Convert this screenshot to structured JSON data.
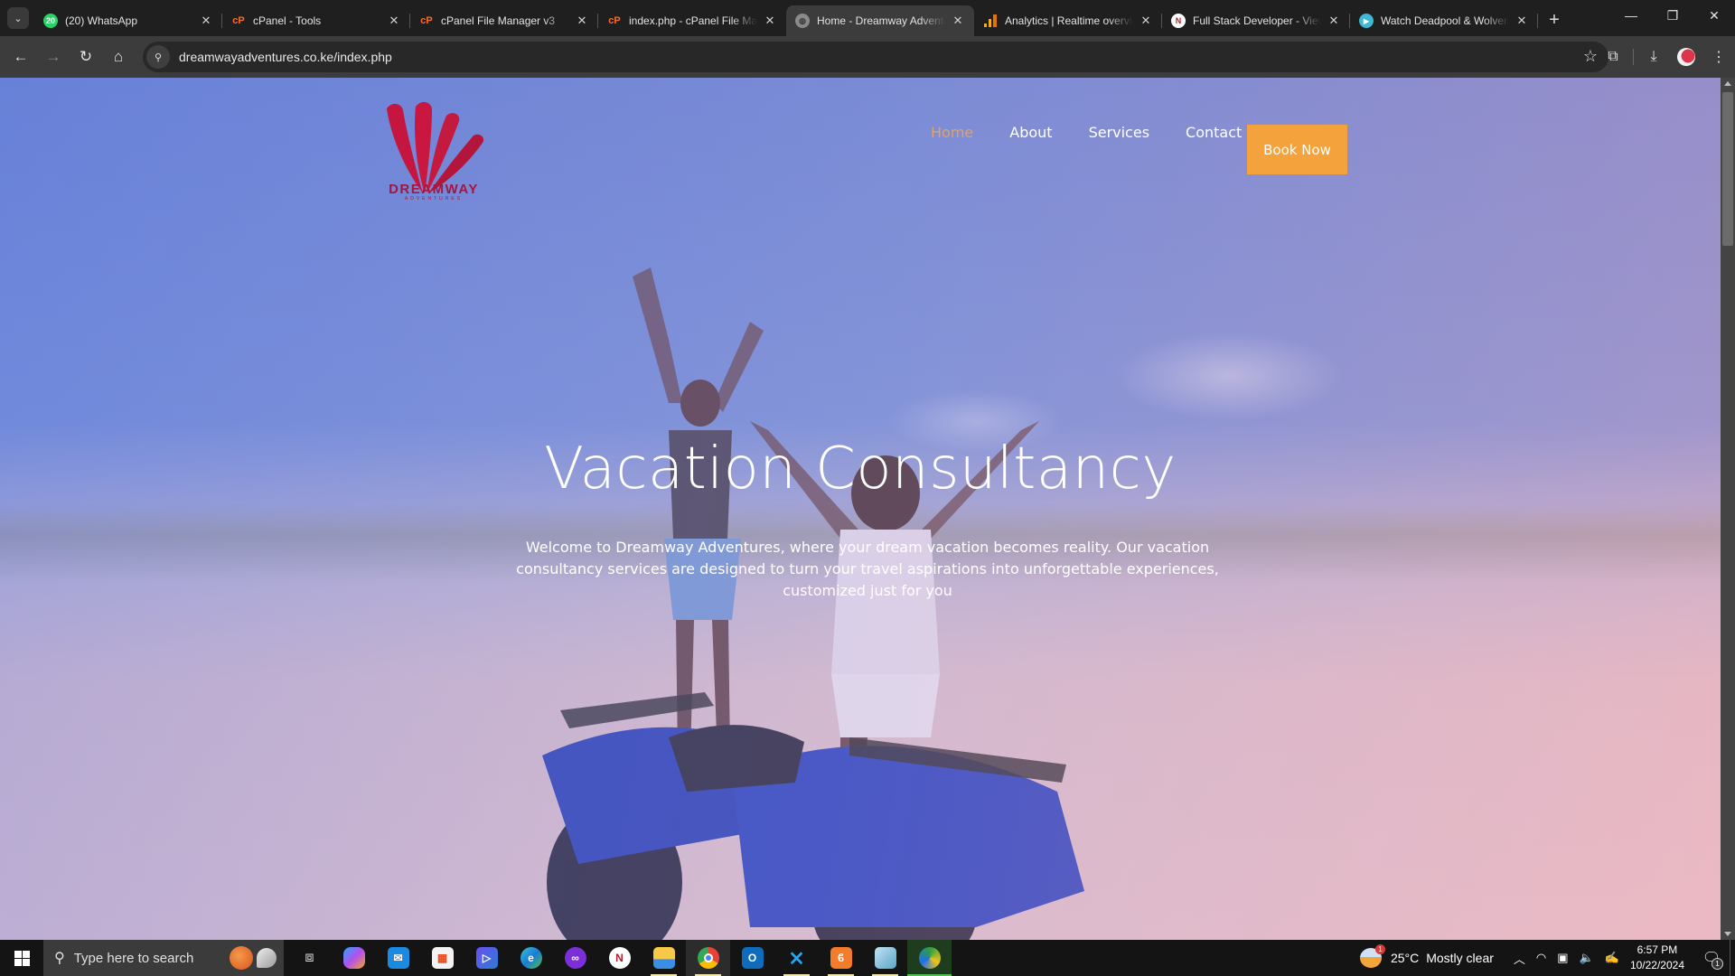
{
  "browser": {
    "tabs": [
      {
        "title": "(20) WhatsApp",
        "favicon": "whatsapp-icon",
        "badge": "20",
        "active": false
      },
      {
        "title": "cPanel - Tools",
        "favicon": "cpanel-icon",
        "active": false
      },
      {
        "title": "cPanel File Manager v3",
        "favicon": "cpanel-icon",
        "active": false
      },
      {
        "title": "index.php - cPanel File Manager",
        "favicon": "cpanel-icon",
        "active": false
      },
      {
        "title": "Home - Dreamway Adventures",
        "favicon": "globe-icon",
        "active": true
      },
      {
        "title": "Analytics | Realtime overview",
        "favicon": "analytics-icon",
        "active": false
      },
      {
        "title": "Full Stack Developer - View",
        "favicon": "n-icon",
        "active": false
      },
      {
        "title": "Watch Deadpool & Wolverine",
        "favicon": "play-icon",
        "active": false
      }
    ],
    "close_glyph": "✕",
    "new_tab_glyph": "+",
    "url": "dreamwayadventures.co.ke/index.php",
    "window_controls": {
      "minimize": "—",
      "restore": "❐",
      "close": "✕"
    }
  },
  "site": {
    "logo": {
      "name": "DREAMWAY",
      "subtitle": "ADVENTURES",
      "color": "#a4163f"
    },
    "nav": [
      {
        "label": "Home",
        "active": true
      },
      {
        "label": "About",
        "active": false
      },
      {
        "label": "Services",
        "active": false
      },
      {
        "label": "Contact",
        "active": false
      }
    ],
    "cta_label": "Book Now",
    "accent_color": "#f4a23c",
    "active_nav_color": "#e6a25b",
    "hero": {
      "title": "Vacation Consultancy",
      "text": "Welcome to Dreamway Adventures, where your dream vacation becomes reality. Our vacation consultancy services are designed to turn your travel aspirations into unforgettable experiences, customized just for you"
    }
  },
  "taskbar": {
    "search_placeholder": "Type here to search",
    "apps": [
      {
        "name": "task-view"
      },
      {
        "name": "copilot"
      },
      {
        "name": "mail"
      },
      {
        "name": "microsoft-store"
      },
      {
        "name": "power-automate"
      },
      {
        "name": "edge"
      },
      {
        "name": "clipchamp"
      },
      {
        "name": "n-app"
      },
      {
        "name": "file-explorer",
        "running": true
      },
      {
        "name": "chrome",
        "running": true,
        "active": true
      },
      {
        "name": "outlook"
      },
      {
        "name": "vscode",
        "running": true
      },
      {
        "name": "xampp",
        "running": true
      },
      {
        "name": "notepad",
        "running": true
      },
      {
        "name": "download-manager",
        "running": true
      }
    ],
    "weather": {
      "temp": "25°C",
      "condition": "Mostly clear",
      "badge": "1"
    },
    "time": "6:57 PM",
    "date": "10/22/2024",
    "notification_count": "1"
  }
}
